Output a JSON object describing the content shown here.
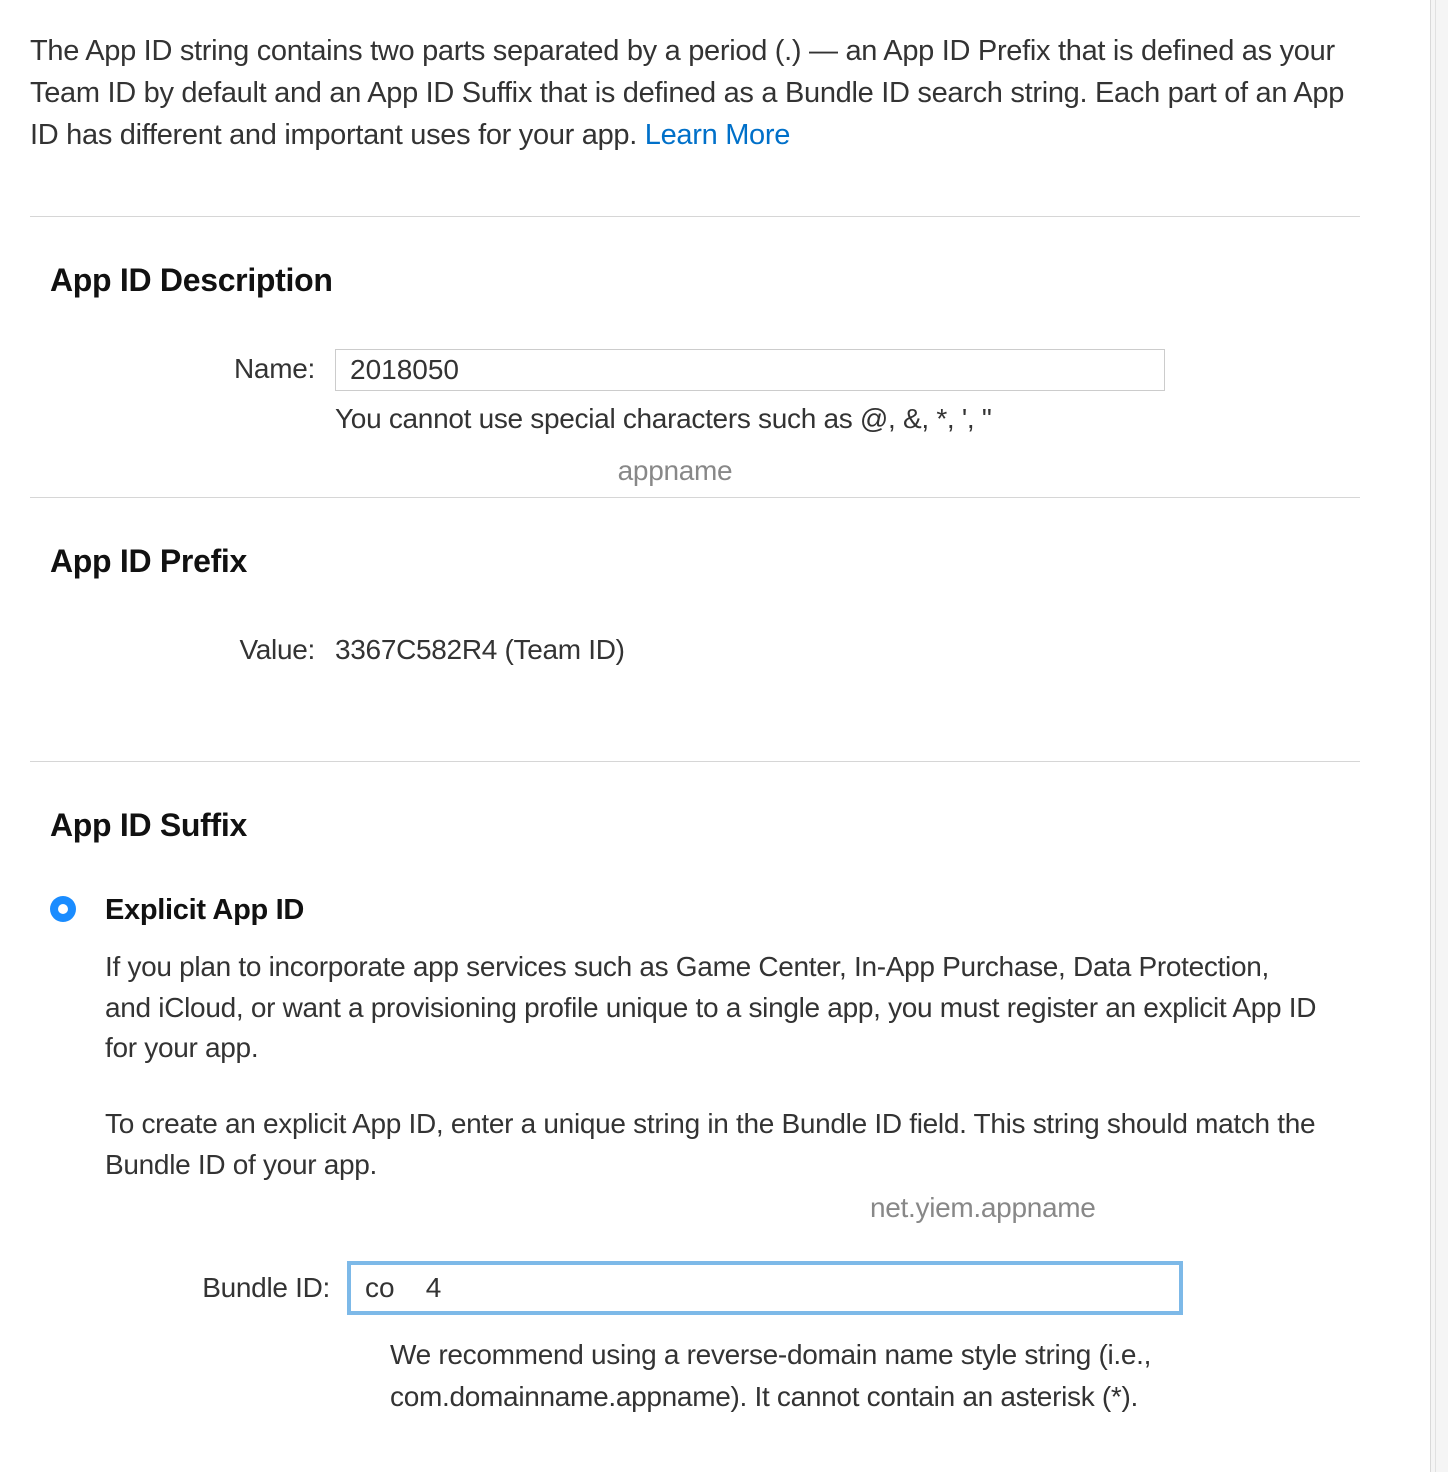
{
  "intro": {
    "text": "The App ID string contains two parts separated by a period (.) — an App ID Prefix that is defined as your Team ID by default and an App ID Suffix that is defined as a Bundle ID search string. Each part of an App ID has different and important uses for your app. ",
    "link_label": "Learn More"
  },
  "description": {
    "heading": "App ID Description",
    "name_label": "Name:",
    "name_value": "2018050",
    "name_hint": "You cannot use special characters such as @, &, *, ', \"",
    "annotation": "appname"
  },
  "prefix": {
    "heading": "App ID Prefix",
    "value_label": "Value:",
    "value_text": "3367C582R4 (Team ID)"
  },
  "suffix": {
    "heading": "App ID Suffix",
    "explicit": {
      "title": "Explicit App ID",
      "desc1": "If you plan to incorporate app services such as Game Center, In-App Purchase, Data Protection, and iCloud, or want a provisioning profile unique to a single app, you must register an explicit App ID for your app.",
      "desc2": "To create an explicit App ID, enter a unique string in the Bundle ID field. This string should match the Bundle ID of your app.",
      "annotation": "net.yiem.appname",
      "bundle_label": "Bundle ID:",
      "bundle_value": "co    4",
      "bundle_hint": "We recommend using a reverse-domain name style string (i.e., com.domainname.appname). It cannot contain an asterisk (*)."
    }
  }
}
